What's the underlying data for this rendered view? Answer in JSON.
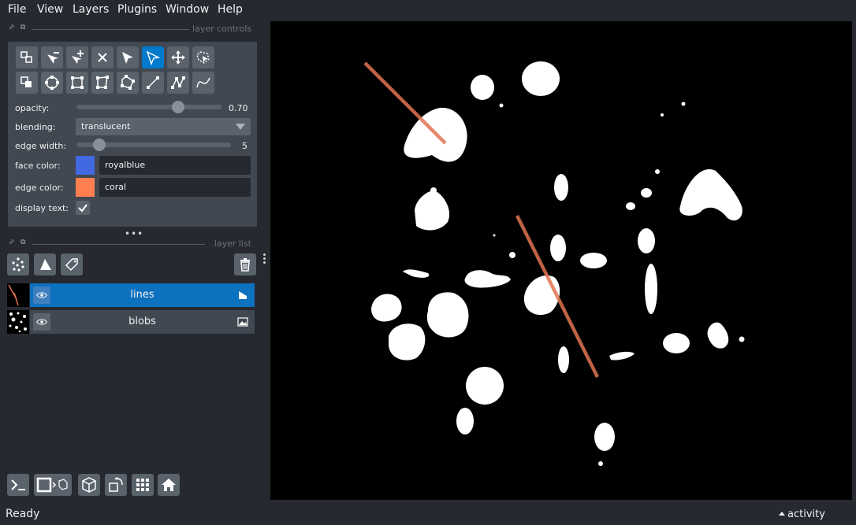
{
  "menu": {
    "file": "File",
    "view": "View",
    "layers": "Layers",
    "plugins": "Plugins",
    "window": "Window",
    "help": "Help"
  },
  "layer_controls": {
    "title": "layer controls",
    "opacity_label": "opacity:",
    "opacity_value": "0.70",
    "opacity_fraction": 0.7,
    "blending_label": "blending:",
    "blending_value": "translucent",
    "edge_width_label": "edge width:",
    "edge_width_value": "5",
    "face_color_label": "face color:",
    "face_color_value": "royalblue",
    "face_color_hex": "#4169e1",
    "edge_color_label": "edge color:",
    "edge_color_value": "coral",
    "edge_color_hex": "#ff7f50",
    "display_text_label": "display text:",
    "display_text_checked": true,
    "tools_row1": [
      "select-vertices-icon",
      "remove-vertex-icon",
      "add-vertex-icon",
      "delete-shape-icon",
      "select-shape-icon",
      "direct-select-icon",
      "move-icon",
      "lasso-select-icon"
    ],
    "tools_row2": [
      "to-back-icon",
      "ellipse-icon",
      "rectangle-icon",
      "polygon-icon",
      "lasso-polygon-icon",
      "line-icon",
      "path-icon",
      "bezier-path-icon"
    ],
    "active_tool": "direct-select-icon"
  },
  "layer_list": {
    "title": "layer list",
    "layers": [
      {
        "name": "lines",
        "selected": true,
        "type": "shapes"
      },
      {
        "name": "blobs",
        "selected": false,
        "type": "image"
      }
    ]
  },
  "status": {
    "text": "Ready",
    "activity": "activity"
  },
  "colors": {
    "accent": "#007acc",
    "line_color": "#e07550"
  }
}
